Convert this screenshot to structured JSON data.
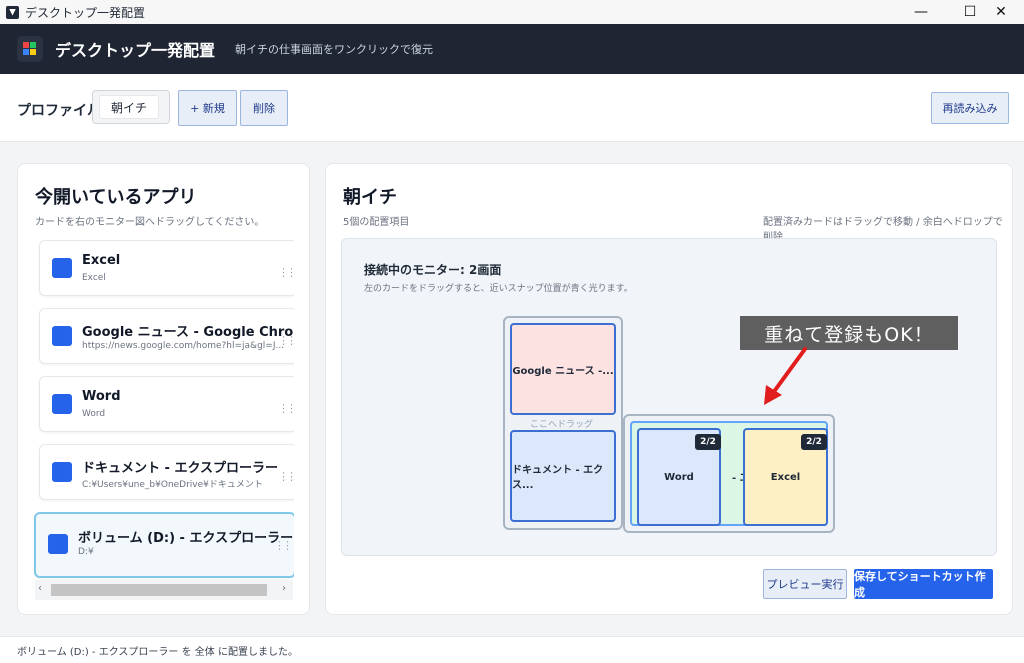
{
  "window": {
    "title": "デスクトップ一発配置"
  },
  "header": {
    "app_name": "デスクトップ一発配置",
    "tagline": "朝イチの仕事画面をワンクリックで復元"
  },
  "profile": {
    "label": "プロファイル",
    "selected": "朝イチ",
    "new_button": "+ 新規",
    "delete_button": "削除",
    "reload_button": "再読み込み"
  },
  "open_apps": {
    "title": "今開いているアプリ",
    "hint": "カードを右のモニター図へドラッグしてください。",
    "items": [
      {
        "name": "Excel",
        "detail": "Excel"
      },
      {
        "name": "Google ニュース - Google Chrome",
        "detail": "https://news.google.com/home?hl=ja&gl=J..."
      },
      {
        "name": "Word",
        "detail": "Word"
      },
      {
        "name": "ドキュメント - エクスプローラー",
        "detail": "C:¥Users¥une_b¥OneDrive¥ドキュメント"
      },
      {
        "name": "ボリューム (D:) - エクスプローラー",
        "detail": "D:¥"
      }
    ]
  },
  "layout": {
    "title": "朝イチ",
    "count": "5個の配置項目",
    "hint": "配置済みカードはドラッグで移動 / 余白へドロップで削除",
    "monitors_title": "接続中のモニター: 2画面",
    "monitors_hint": "左のカードをドラッグすると、近いスナップ位置が青く光ります。",
    "drop_hint": "ここへドラッグ",
    "windows": {
      "chrome": "Google ニュース -...",
      "explorer": "ドキュメント - エクス...",
      "word": "Word",
      "excel": "Excel",
      "hidden": "- エ"
    },
    "badge": "2/2"
  },
  "callout": "重ねて登録もOK！",
  "actions": {
    "preview": "プレビュー実行",
    "save": "保存してショートカット作成"
  },
  "status": "ボリューム (D:) - エクスプローラー を 全体 に配置しました。"
}
